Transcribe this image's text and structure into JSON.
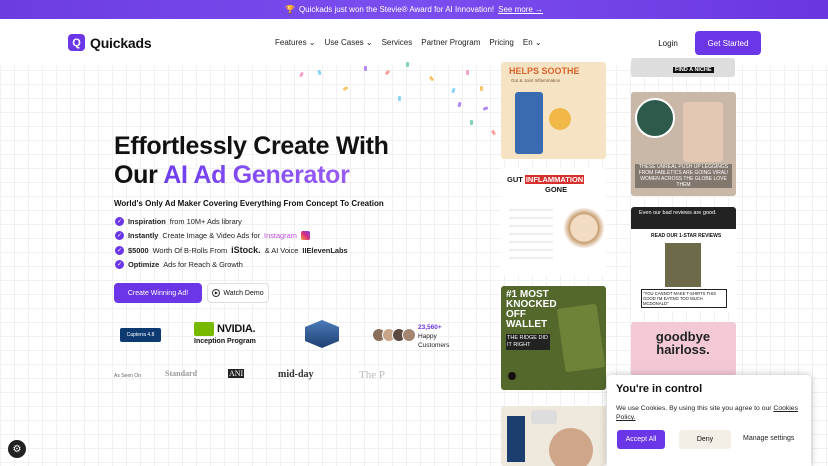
{
  "banner": {
    "text": "Quickads just won the Stevie® Award for AI Innovation!",
    "link": "See more →"
  },
  "logo": {
    "text": "Quickads",
    "mark": "Q"
  },
  "nav": {
    "items": [
      "Features",
      "Use Cases",
      "Services",
      "Partner Program",
      "Pricing",
      "En"
    ],
    "login": "Login",
    "get_started": "Get Started"
  },
  "hero": {
    "line1": "Effortlessly Create With",
    "line2a": "Our ",
    "line2b": "AI Ad Generator",
    "subtitle": "World's Only Ad Maker Covering Everything From Concept To Creation",
    "features": [
      {
        "bold": "Inspiration",
        "rest": " from 10M+ Ads library"
      },
      {
        "bold": "Instantly",
        "rest": " Create Image & Video Ads for ",
        "tail": "Instagram"
      },
      {
        "bold": "$5000",
        "rest": " Worth Of B-Rolls From ",
        "tail2": "iStock.",
        "tail3": " & AI Voice ",
        "tail4": "IIElevenLabs"
      },
      {
        "bold": "Optimize",
        "rest": " Ads for Reach & Growth"
      }
    ],
    "cta": "Create Winning Ad!",
    "demo": "Watch Demo"
  },
  "trust": {
    "capterra": "Capterra 4.8",
    "nvidia": "NVIDIA.",
    "nvidia_sub": "Inception Program",
    "count": "23,560+",
    "count_label1": "Happy",
    "count_label2": "Customers"
  },
  "press": {
    "seen": "As Seen On",
    "logos": [
      "Standard",
      "ANI",
      "mid-day",
      "The P"
    ]
  },
  "ads": {
    "a1": "HELPS SOOTHE",
    "a1b": "Gut & Joint Inflammation",
    "a2a": "GUT",
    "a2b": "INFLAMMATION",
    "a2c": "GONE",
    "a3": "#1 MOST KNOCKED OFF WALLET",
    "a3b": "THE RIDGE DID IT RIGHT",
    "b0": "FIND A NICHE",
    "b1": "THESE UNREAL PUSH UP LEGGINGS FROM FABLETICS ARE GOING VIRAL! WOMEN ACROSS THE GLOBE LOVE THEM",
    "b2": "Even our bad reviews are good.",
    "b2b": "READ OUR 1-STAR REVIEWS",
    "b2c": "\"YOU CANNOT MAKE T-SHIRTS THIS GOOD I'M EATING TOO MUCH MCDONALD\"",
    "b3": "goodbye hairloss."
  },
  "cookie": {
    "title": "You're in control",
    "text": "We use Cookies. By using this site you agree to our",
    "policy": "Cookies Policy.",
    "accept": "Accept All",
    "deny": "Deny",
    "manage": "Manage settings"
  },
  "colors": {
    "brand": "#6b35e8",
    "dark": "#111111"
  }
}
